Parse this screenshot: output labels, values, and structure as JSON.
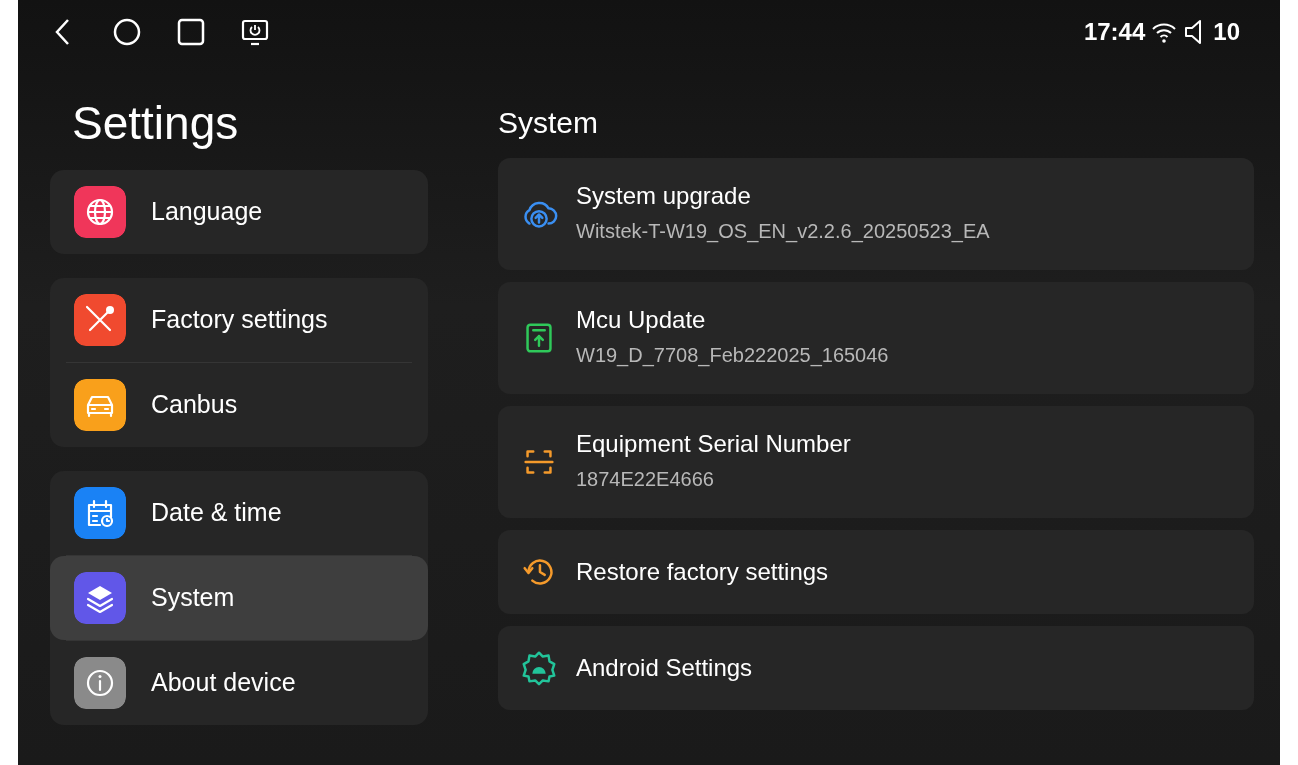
{
  "status_bar": {
    "time": "17:44",
    "volume": "10"
  },
  "sidebar": {
    "title": "Settings",
    "groups": [
      {
        "items": [
          {
            "label": "Language",
            "kind": "globe",
            "color": "#f0365a",
            "selected": false
          }
        ]
      },
      {
        "items": [
          {
            "label": "Factory settings",
            "kind": "tools",
            "color": "#f04a2f",
            "selected": false
          },
          {
            "label": "Canbus",
            "kind": "car",
            "color": "#f9a01b",
            "selected": false
          }
        ]
      },
      {
        "items": [
          {
            "label": "Date & time",
            "kind": "calendar",
            "color": "#1a82f5",
            "selected": false
          },
          {
            "label": "System",
            "kind": "layers",
            "color": "#6157e8",
            "selected": true
          },
          {
            "label": "About device",
            "kind": "info",
            "color": "#8a8a8a",
            "selected": false
          }
        ]
      }
    ]
  },
  "content": {
    "title": "System",
    "items": [
      {
        "title": "System upgrade",
        "subtitle": "Witstek-T-W19_OS_EN_v2.2.6_20250523_EA",
        "kind": "cloud",
        "color": "#3a8ff2"
      },
      {
        "title": "Mcu Update",
        "subtitle": "W19_D_7708_Feb222025_165046",
        "kind": "upload",
        "color": "#2fc95a"
      },
      {
        "title": "Equipment Serial Number",
        "subtitle": "1874E22E4666",
        "kind": "scan",
        "color": "#f59a2b"
      },
      {
        "title": "Restore factory settings",
        "kind": "restore",
        "color": "#f59a2b"
      },
      {
        "title": "Android Settings",
        "kind": "android",
        "color": "#22c49a"
      }
    ]
  }
}
